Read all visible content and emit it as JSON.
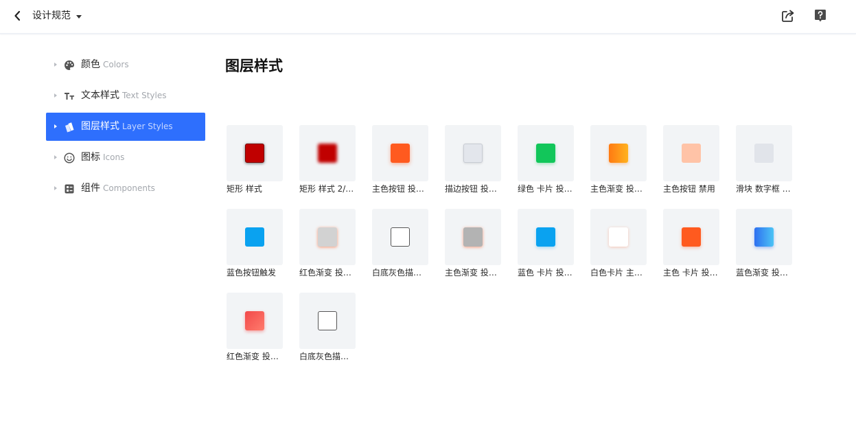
{
  "header": {
    "title": "设计规范",
    "back_icon": "chevron-left-icon",
    "dropdown_icon": "caret-down-icon",
    "share_icon": "share-icon",
    "help_icon": "help-icon"
  },
  "sidebar": {
    "items": [
      {
        "label": "颜色",
        "sub": "Colors",
        "icon": "palette-icon",
        "active": false
      },
      {
        "label": "文本样式",
        "sub": "Text Styles",
        "icon": "text-style-icon",
        "active": false
      },
      {
        "label": "图层样式",
        "sub": "Layer Styles",
        "icon": "layer-style-icon",
        "active": true
      },
      {
        "label": "图标",
        "sub": "Icons",
        "icon": "smiley-icon",
        "active": false
      },
      {
        "label": "组件",
        "sub": "Components",
        "icon": "component-icon",
        "active": false
      }
    ]
  },
  "main": {
    "title": "图层样式",
    "styles": [
      {
        "label": "矩形 样式"
      },
      {
        "label": "矩形 样式 2/…"
      },
      {
        "label": "主色按钮 投…"
      },
      {
        "label": "描边按钮 投…"
      },
      {
        "label": "绿色 卡片 投…"
      },
      {
        "label": "主色渐变 投…"
      },
      {
        "label": "主色按钮 禁用"
      },
      {
        "label": "滑块 数字框 …"
      },
      {
        "label": "蓝色按钮触发"
      },
      {
        "label": "红色渐变 投…"
      },
      {
        "label": "白底灰色描…"
      },
      {
        "label": "主色渐变 投…"
      },
      {
        "label": "蓝色 卡片 投…"
      },
      {
        "label": "白色卡片 主…"
      },
      {
        "label": "主色 卡片 投…"
      },
      {
        "label": "蓝色渐变 投…"
      },
      {
        "label": "红色渐变 投…"
      },
      {
        "label": "白底灰色描…"
      }
    ]
  },
  "colors": {
    "accent": "#2e6ffd",
    "primary_orange": "#ff5a1f",
    "green": "#12c65a",
    "blue": "#0aa2f0",
    "red": "#c00000"
  }
}
